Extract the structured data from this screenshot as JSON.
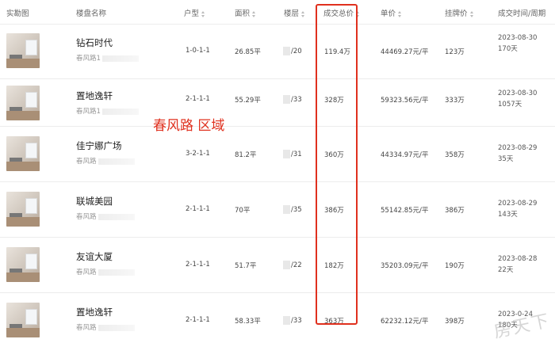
{
  "header": {
    "photo": "实勘图",
    "community": "楼盘名称",
    "layout": "户型",
    "area": "面积",
    "floor": "楼层",
    "total_price": "成交总价",
    "unit_price": "单价",
    "list_price": "挂牌价",
    "deal_time": "成交时间/周期"
  },
  "annotation": {
    "region_label": "春风路 区域",
    "highlight_color": "#e0301e"
  },
  "watermark": "房天下",
  "rows": [
    {
      "name": "钻石时代",
      "addr": "春风路1",
      "layout": "1-0-1-1",
      "area": "26.85平",
      "floor": "/20",
      "total": "119.4万",
      "unit": "44469.27元/平",
      "list": "123万",
      "date": "2023-08-30",
      "cycle": "170天"
    },
    {
      "name": "置地逸轩",
      "addr": "春风路1",
      "layout": "2-1-1-1",
      "area": "55.29平",
      "floor": "/33",
      "total": "328万",
      "unit": "59323.56元/平",
      "list": "333万",
      "date": "2023-08-30",
      "cycle": "1057天"
    },
    {
      "name": "佳宁娜广场",
      "addr": "春风路",
      "layout": "3-2-1-1",
      "area": "81.2平",
      "floor": "/31",
      "total": "360万",
      "unit": "44334.97元/平",
      "list": "358万",
      "date": "2023-08-29",
      "cycle": "35天"
    },
    {
      "name": "联城美园",
      "addr": "春风路",
      "layout": "2-1-1-1",
      "area": "70平",
      "floor": "/35",
      "total": "386万",
      "unit": "55142.85元/平",
      "list": "386万",
      "date": "2023-08-29",
      "cycle": "143天"
    },
    {
      "name": "友谊大厦",
      "addr": "春风路",
      "layout": "2-1-1-1",
      "area": "51.7平",
      "floor": "/22",
      "total": "182万",
      "unit": "35203.09元/平",
      "list": "190万",
      "date": "2023-08-28",
      "cycle": "22天"
    },
    {
      "name": "置地逸轩",
      "addr": "春风路",
      "layout": "2-1-1-1",
      "area": "58.33平",
      "floor": "/33",
      "total": "363万",
      "unit": "62232.12元/平",
      "list": "398万",
      "date": "2023-0-24",
      "cycle": "180天"
    }
  ]
}
